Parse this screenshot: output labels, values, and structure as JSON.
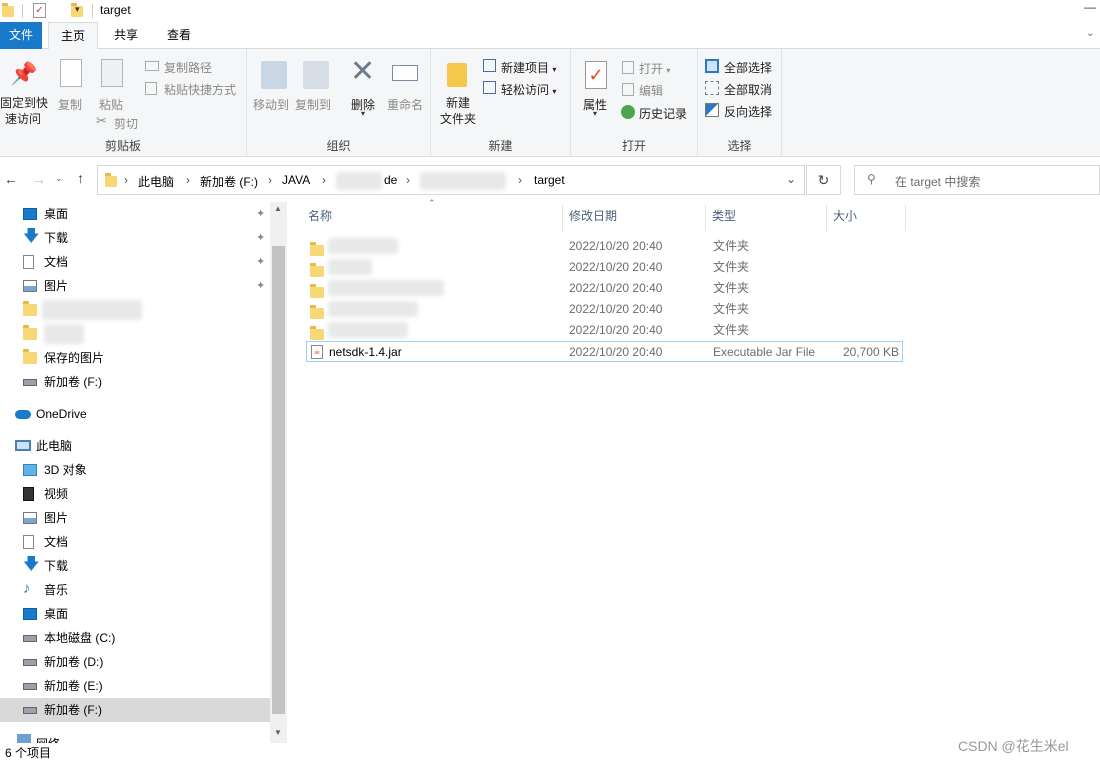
{
  "window": {
    "title": "target"
  },
  "tabs": [
    {
      "label": "文件"
    },
    {
      "label": "主页"
    },
    {
      "label": "共享"
    },
    {
      "label": "查看"
    }
  ],
  "ribbon": {
    "clipboard": {
      "pin_line1": "固定到快",
      "pin_line2": "速访问",
      "copy": "复制",
      "paste": "粘贴",
      "copy_path": "复制路径",
      "paste_shortcut": "粘贴快捷方式",
      "cut": "剪切",
      "label": "剪贴板"
    },
    "organize": {
      "move_to": "移动到",
      "copy_to": "复制到",
      "delete": "删除",
      "rename": "重命名",
      "label": "组织"
    },
    "new": {
      "new_folder_line1": "新建",
      "new_folder_line2": "文件夹",
      "new_item": "新建项目",
      "easy_access": "轻松访问",
      "label": "新建"
    },
    "open": {
      "properties": "属性",
      "open": "打开",
      "edit": "编辑",
      "history": "历史记录",
      "label": "打开"
    },
    "select": {
      "select_all": "全部选择",
      "select_none": "全部取消",
      "invert": "反向选择",
      "label": "选择"
    }
  },
  "address": {
    "crumbs": [
      "此电脑",
      "新加卷 (F:)",
      "JAVA",
      "de",
      "target"
    ],
    "search_placeholder": "在 target 中搜索"
  },
  "sidebar": {
    "quick": [
      {
        "label": "桌面"
      },
      {
        "label": "下载"
      },
      {
        "label": "文档"
      },
      {
        "label": "图片"
      },
      {
        "label": "保存的图片"
      },
      {
        "label": "新加卷 (F:)"
      }
    ],
    "onedrive": "OneDrive",
    "thispc": "此电脑",
    "pc_items": [
      {
        "label": "3D 对象"
      },
      {
        "label": "视频"
      },
      {
        "label": "图片"
      },
      {
        "label": "文档"
      },
      {
        "label": "下载"
      },
      {
        "label": "音乐"
      },
      {
        "label": "桌面"
      },
      {
        "label": "本地磁盘 (C:)"
      },
      {
        "label": "新加卷 (D:)"
      },
      {
        "label": "新加卷 (E:)"
      },
      {
        "label": "新加卷 (F:)"
      }
    ],
    "network": "网络"
  },
  "columns": {
    "name": "名称",
    "date": "修改日期",
    "type": "类型",
    "size": "大小"
  },
  "files": [
    {
      "name": "",
      "date": "2022/10/20 20:40",
      "type": "文件夹",
      "size": ""
    },
    {
      "name": "",
      "date": "2022/10/20 20:40",
      "type": "文件夹",
      "size": ""
    },
    {
      "name": "",
      "date": "2022/10/20 20:40",
      "type": "文件夹",
      "size": ""
    },
    {
      "name": "",
      "date": "2022/10/20 20:40",
      "type": "文件夹",
      "size": ""
    },
    {
      "name": "",
      "date": "2022/10/20 20:40",
      "type": "文件夹",
      "size": ""
    },
    {
      "name": "netsdk-1.4.jar",
      "date": "2022/10/20 20:40",
      "type": "Executable Jar File",
      "size": "20,700 KB"
    }
  ],
  "status": {
    "count": "6 个项目"
  },
  "watermark": "CSDN @花生米el",
  "colors": {
    "accent": "#1979ca",
    "selected_row_border": "#99d1ff",
    "nav_selected": "#d9d9d9"
  }
}
